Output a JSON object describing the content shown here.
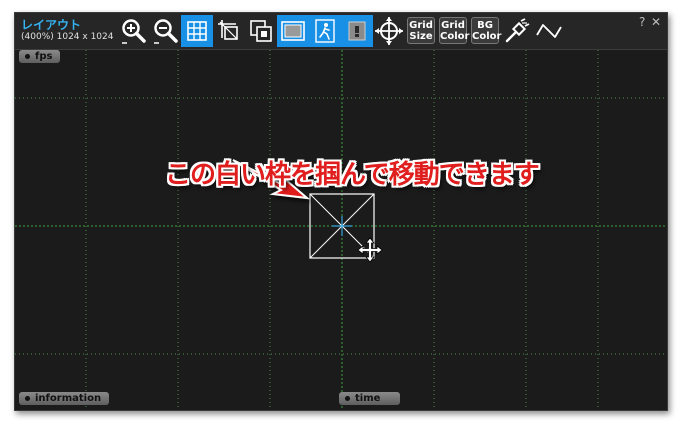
{
  "window": {
    "title": "レイアウト",
    "subtitle": "(400%) 1024 x 1024",
    "help": "?",
    "close": "✕"
  },
  "toolbar": {
    "buttons": [
      {
        "name": "zoom-in",
        "active": false
      },
      {
        "name": "zoom-out",
        "active": false
      },
      {
        "name": "grid-toggle",
        "active": true
      },
      {
        "name": "crop-tool",
        "active": false
      },
      {
        "name": "snap-tool",
        "active": false
      },
      {
        "name": "frame-toggle",
        "active": true
      },
      {
        "name": "safe-area",
        "active": true
      },
      {
        "name": "lock-tool",
        "active": true
      },
      {
        "name": "move-center",
        "active": false
      }
    ],
    "grid_size": [
      "Grid",
      "Size"
    ],
    "grid_color": [
      "Grid",
      "Color"
    ],
    "bg_color": [
      "BG",
      "Color"
    ]
  },
  "panels": {
    "fps": "fps",
    "information": "information",
    "time": "time"
  },
  "annotation": "この白い枠を掴んで移動できます",
  "colors": {
    "accent": "#1890e6",
    "grid": "#4a8a4a",
    "annotation": "#e01e1e",
    "background": "#1b1b1b"
  }
}
